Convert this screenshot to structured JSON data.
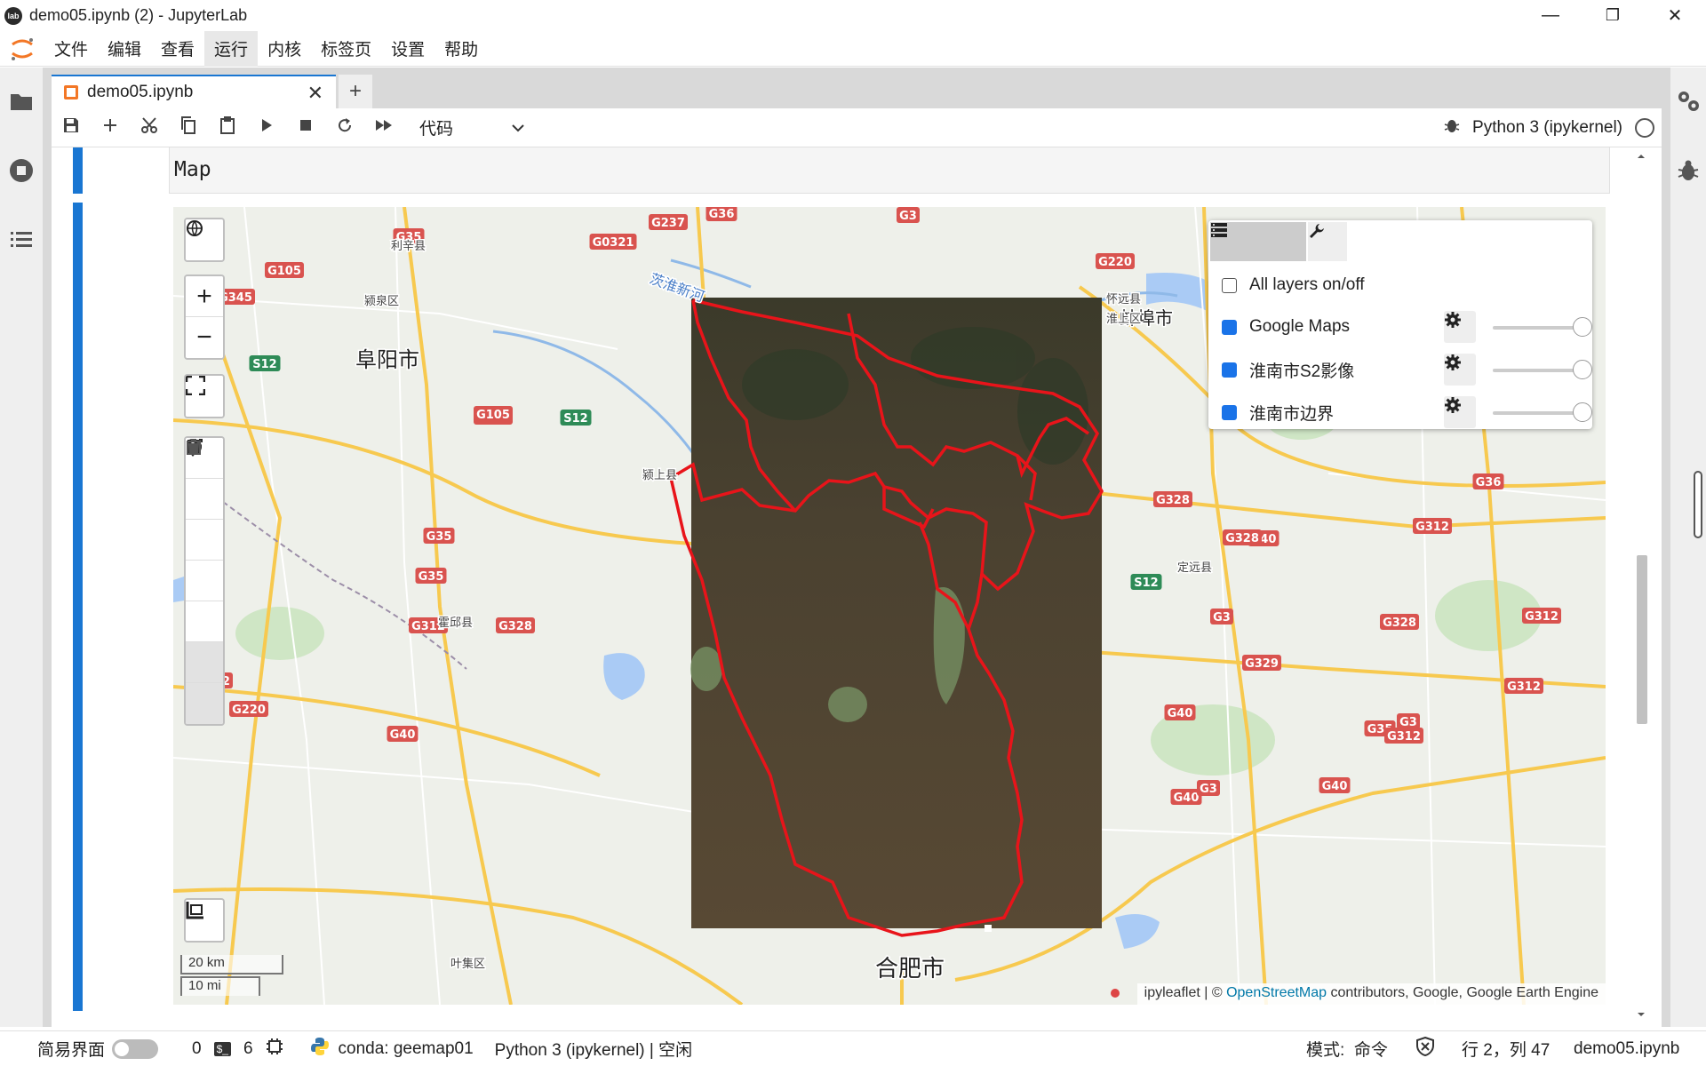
{
  "window": {
    "title": "demo05.ipynb (2) - JupyterLab",
    "logo_text": "lab",
    "minimize": "—",
    "maximize": "❐",
    "close": "✕"
  },
  "menu": [
    "文件",
    "编辑",
    "查看",
    "运行",
    "内核",
    "标签页",
    "设置",
    "帮助"
  ],
  "tab": {
    "title": "demo05.ipynb",
    "close": "✕",
    "add": "+"
  },
  "toolbar": {
    "cell_type": "代码",
    "kernel_name": "Python 3 (ipykernel)"
  },
  "cell": {
    "code_visible_line": "Map"
  },
  "map": {
    "layer_panel": {
      "rows": [
        {
          "label": "All layers on/off",
          "checked": false
        },
        {
          "label": "Google Maps",
          "checked": true,
          "opacity": 1.0
        },
        {
          "label": "淮南市S2影像",
          "checked": true,
          "opacity": 1.0
        },
        {
          "label": "淮南市边界",
          "checked": true,
          "opacity": 1.0
        }
      ]
    },
    "scale": {
      "metric": "20 km",
      "imperial": "10 mi"
    },
    "attribution": {
      "prefix": "ipyleaflet | © ",
      "osm": "OpenStreetMap",
      "suffix": " contributors, Google, Google Earth Engine"
    },
    "city_labels": [
      {
        "id": "fuyang",
        "text": "阜阳市"
      },
      {
        "id": "hefei",
        "text": "合肥市"
      },
      {
        "id": "bengbu",
        "text": "蚌埠市"
      },
      {
        "id": "yingzhou",
        "text": "颍泉区"
      },
      {
        "id": "lixin",
        "text": "利辛县"
      },
      {
        "id": "yingshang",
        "text": "颍上县"
      },
      {
        "id": "huoqiu",
        "text": "霍邱县"
      },
      {
        "id": "dingyuan",
        "text": "定远县"
      },
      {
        "id": "huaishang",
        "text": "淮上区"
      },
      {
        "id": "huaiyuan",
        "text": "怀远县"
      },
      {
        "id": "yeji",
        "text": "叶集区"
      },
      {
        "id": "river",
        "text": "茨淮新河"
      }
    ],
    "road_shields": [
      "G35",
      "G0321",
      "G237",
      "G36",
      "G3",
      "G105",
      "G345",
      "S12",
      "G220",
      "G329",
      "G36",
      "G328",
      "G312",
      "G40",
      "S12",
      "G3",
      "G328",
      "G312",
      "G329",
      "G40",
      "G3",
      "G312",
      "G40",
      "G35",
      "G328",
      "G220",
      "G312",
      "G40",
      "G312",
      "G220",
      "G35",
      "G105",
      "G35",
      "S12",
      "G36",
      "G328",
      "G312",
      "G3",
      "G40"
    ],
    "colors": {
      "land": "#eef0ea",
      "green": "#cfe6c5",
      "water": "#aacbf5",
      "road_major": "#f7c94f",
      "boundary": "#e8141a",
      "satellite": "#4a4330"
    }
  },
  "statusbar": {
    "simple_mode": "简易界面",
    "count_a": "0",
    "terminal_icon": "$_",
    "count_b": "6",
    "env": "conda: geemap01",
    "kernel_status": "Python 3 (ipykernel) | 空闲",
    "mode": "模式:  命令",
    "cursor": "行 2，列 47",
    "file": "demo05.ipynb"
  }
}
